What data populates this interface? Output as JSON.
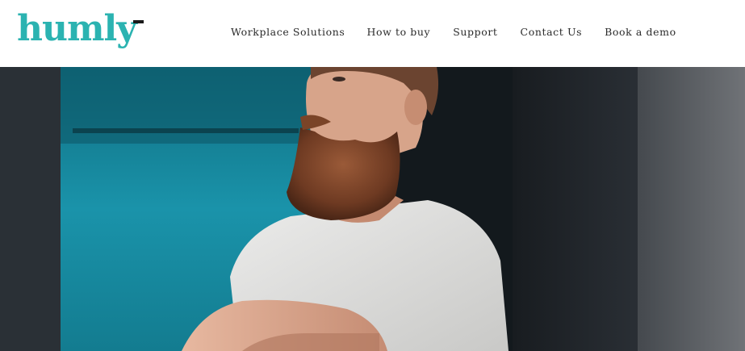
{
  "brand": {
    "logo_text": "humly",
    "accent_color": "#2bb3b1"
  },
  "nav": {
    "items": [
      {
        "label": "Workplace Solutions"
      },
      {
        "label": "How to buy"
      },
      {
        "label": "Support"
      },
      {
        "label": "Contact Us"
      },
      {
        "label": "Book a demo"
      }
    ]
  },
  "hero": {
    "subject": "bearded man in light grey t-shirt with crossed arms against teal backdrop",
    "backdrop_color": "#1a8aa0"
  }
}
